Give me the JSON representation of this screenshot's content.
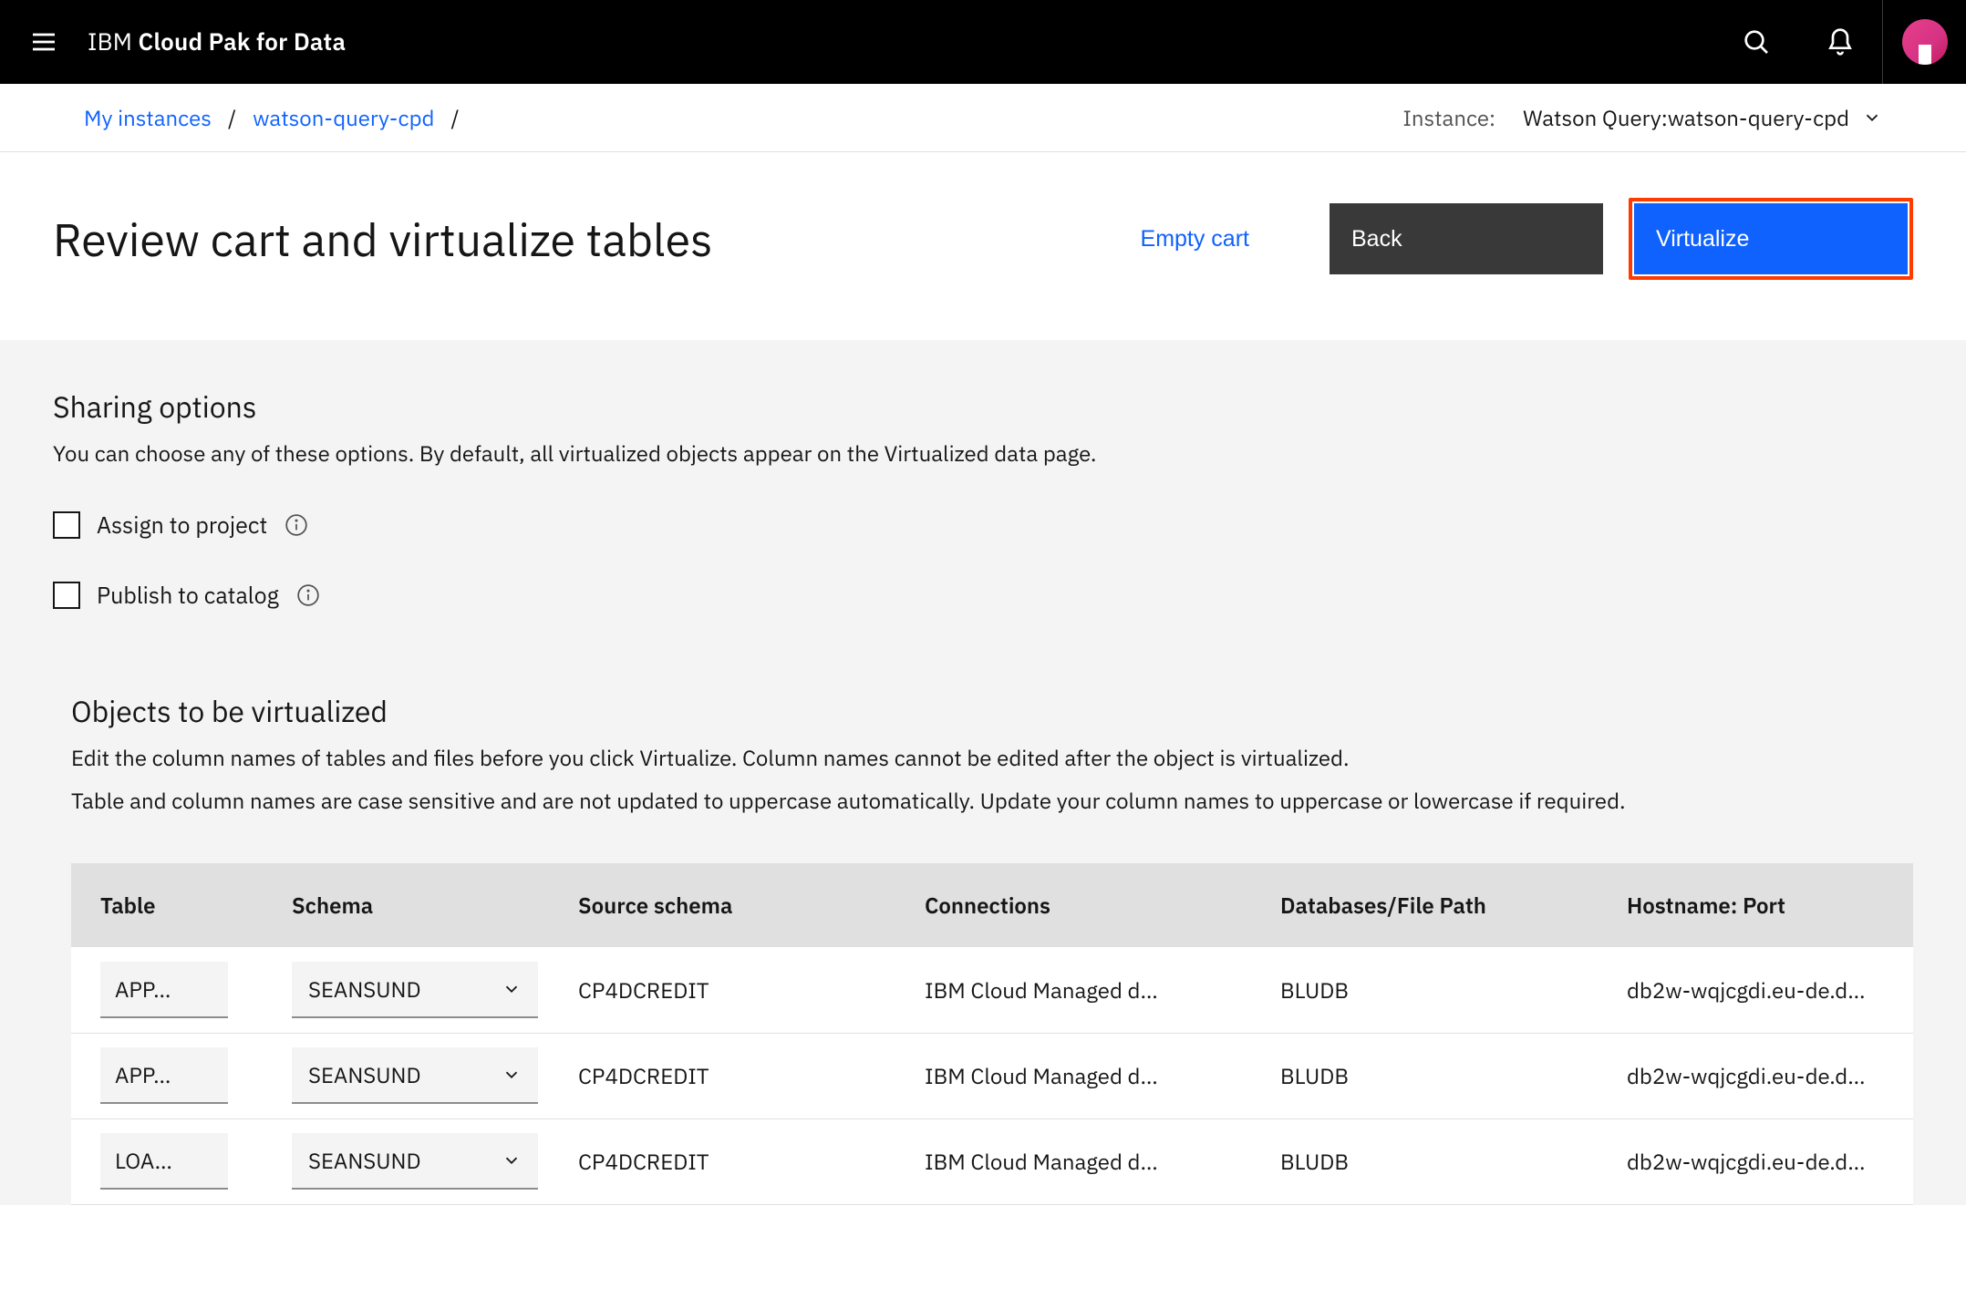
{
  "header": {
    "brand_prefix": "IBM ",
    "brand_bold": "Cloud Pak for Data"
  },
  "breadcrumb": {
    "items": [
      "My instances",
      "watson-query-cpd"
    ],
    "instance_label": "Instance:",
    "instance_value": "Watson Query:watson-query-cpd"
  },
  "title": {
    "page_title": "Review cart and virtualize tables",
    "empty_cart": "Empty cart",
    "back": "Back",
    "virtualize": "Virtualize"
  },
  "sharing": {
    "heading": "Sharing options",
    "desc": "You can choose any of these options. By default, all virtualized objects appear on the Virtualized data page.",
    "opt_assign": "Assign to project",
    "opt_publish": "Publish to catalog"
  },
  "objects": {
    "heading": "Objects to be virtualized",
    "desc_line1": "Edit the column names of tables and files before you click Virtualize. Column names cannot be edited after the object is virtualized.",
    "desc_line2": "Table and column names are case sensitive and are not updated to uppercase automatically. Update your column names to uppercase or lowercase if required.",
    "columns": {
      "c1": "Table",
      "c2": "Schema",
      "c3": "Source schema",
      "c4": "Connections",
      "c5": "Databases/File Path",
      "c6": "Hostname: Port"
    },
    "rows": [
      {
        "table": "APP…",
        "schema": "SEANSUND",
        "source": "CP4DCREDIT",
        "conn": "IBM Cloud Managed d…",
        "db": "BLUDB",
        "host": "db2w-wqjcgdi.eu-de.d…"
      },
      {
        "table": "APP…",
        "schema": "SEANSUND",
        "source": "CP4DCREDIT",
        "conn": "IBM Cloud Managed d…",
        "db": "BLUDB",
        "host": "db2w-wqjcgdi.eu-de.d…"
      },
      {
        "table": "LOA…",
        "schema": "SEANSUND",
        "source": "CP4DCREDIT",
        "conn": "IBM Cloud Managed d…",
        "db": "BLUDB",
        "host": "db2w-wqjcgdi.eu-de.d…"
      }
    ]
  }
}
